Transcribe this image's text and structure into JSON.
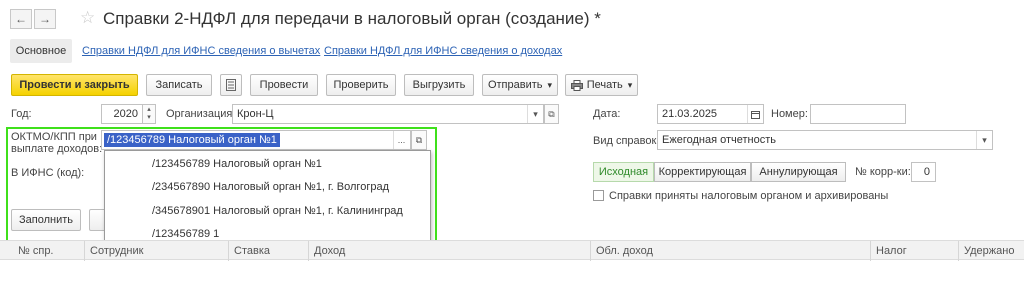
{
  "window": {
    "title": "Справки 2-НДФЛ для передачи в налоговый орган (создание) *"
  },
  "nav": {
    "back": "←",
    "forward": "→",
    "star": "☆"
  },
  "tabs": [
    {
      "label": "Основное"
    },
    {
      "label": "Справки НДФЛ для ИФНС сведения о вычетах"
    },
    {
      "label": "Справки НДФЛ для ИФНС сведения о доходах"
    }
  ],
  "toolbar": {
    "post_close": "Провести и закрыть",
    "save": "Записать",
    "post": "Провести",
    "check": "Проверить",
    "export": "Выгрузить",
    "send": "Отправить",
    "print": "Печать",
    "dropdown_arrow": "▾"
  },
  "form": {
    "year_label": "Год:",
    "year_value": "2020",
    "org_label": "Организация:",
    "org_value": "Крон-Ц",
    "date_label": "Дата:",
    "date_value": "21.03.2025",
    "number_label": "Номер:",
    "number_value": "",
    "oktmo_label_line1": "ОКТМО/КПП при",
    "oktmo_label_line2": "выплате доходов:",
    "oktmo_value": "/123456789 Налоговый орган №1",
    "ifns_label": "В ИФНС (код):",
    "report_type_label": "Вид справок:",
    "report_type_value": "Ежегодная отчетность",
    "kind_options": [
      "Исходная",
      "Корректирующая",
      "Аннулирующая"
    ],
    "corr_label": "№ корр-ки:",
    "corr_value": "0",
    "accepted_label": "Справки приняты налоговым органом и архивированы",
    "fill_button": "Заполнить"
  },
  "dropdown": {
    "items": [
      "/123456789 Налоговый орган №1",
      "/234567890 Налоговый орган №1, г. Волгоград",
      "/345678901 Налоговый орган №1, г. Калининград",
      "/123456789 1"
    ]
  },
  "table": {
    "columns": [
      "№ спр.",
      "Сотрудник",
      "Ставка",
      "Доход",
      "Обл. доход",
      "Налог",
      "Удержано"
    ]
  },
  "colors": {
    "accent": "#f5d200",
    "highlight": "#3fe01b",
    "link": "#2d63b5",
    "selection": "#3a62c7"
  }
}
